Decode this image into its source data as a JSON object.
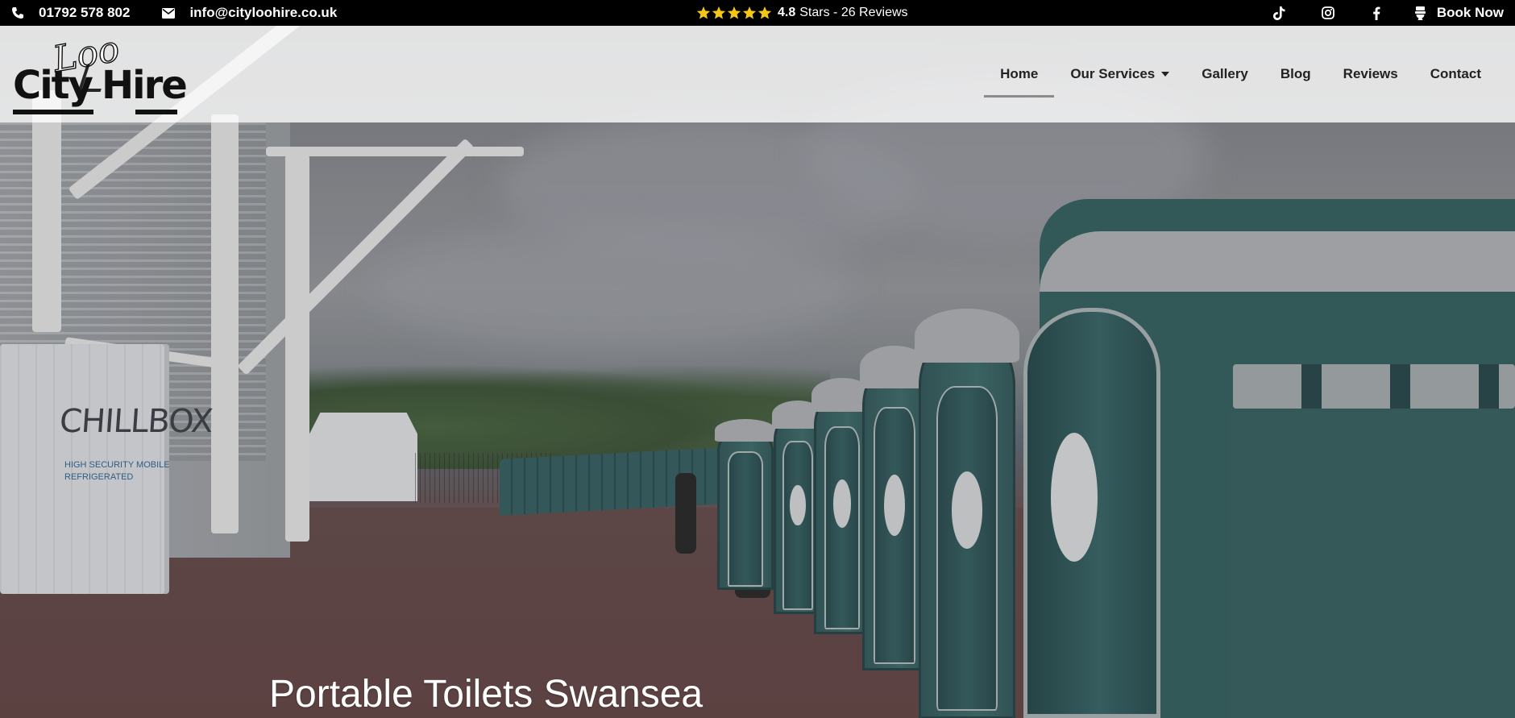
{
  "topbar": {
    "phone": "01792 578 802",
    "email": "info@cityloohire.co.uk",
    "rating_value": "4.8",
    "rating_text": "Stars - 26 Reviews",
    "stars_count": 5,
    "social_icons": [
      "tiktok-icon",
      "instagram-icon",
      "facebook-icon"
    ],
    "book_label": "Book Now",
    "star_color": "#f5c518"
  },
  "logo": {
    "loo": "Loo",
    "city": "City",
    "hire": "Hire"
  },
  "nav": {
    "items": [
      {
        "label": "Home",
        "active": true
      },
      {
        "label": "Our Services",
        "dropdown": true
      },
      {
        "label": "Gallery"
      },
      {
        "label": "Blog"
      },
      {
        "label": "Reviews"
      },
      {
        "label": "Contact"
      }
    ]
  },
  "hero": {
    "title": "Portable Toilets Swansea",
    "chillbox_brand": "CHILLBOX",
    "chillbox_sub_1": "HIGH SECURITY MOBILE",
    "chillbox_sub_2": "REFRIGERATED"
  }
}
